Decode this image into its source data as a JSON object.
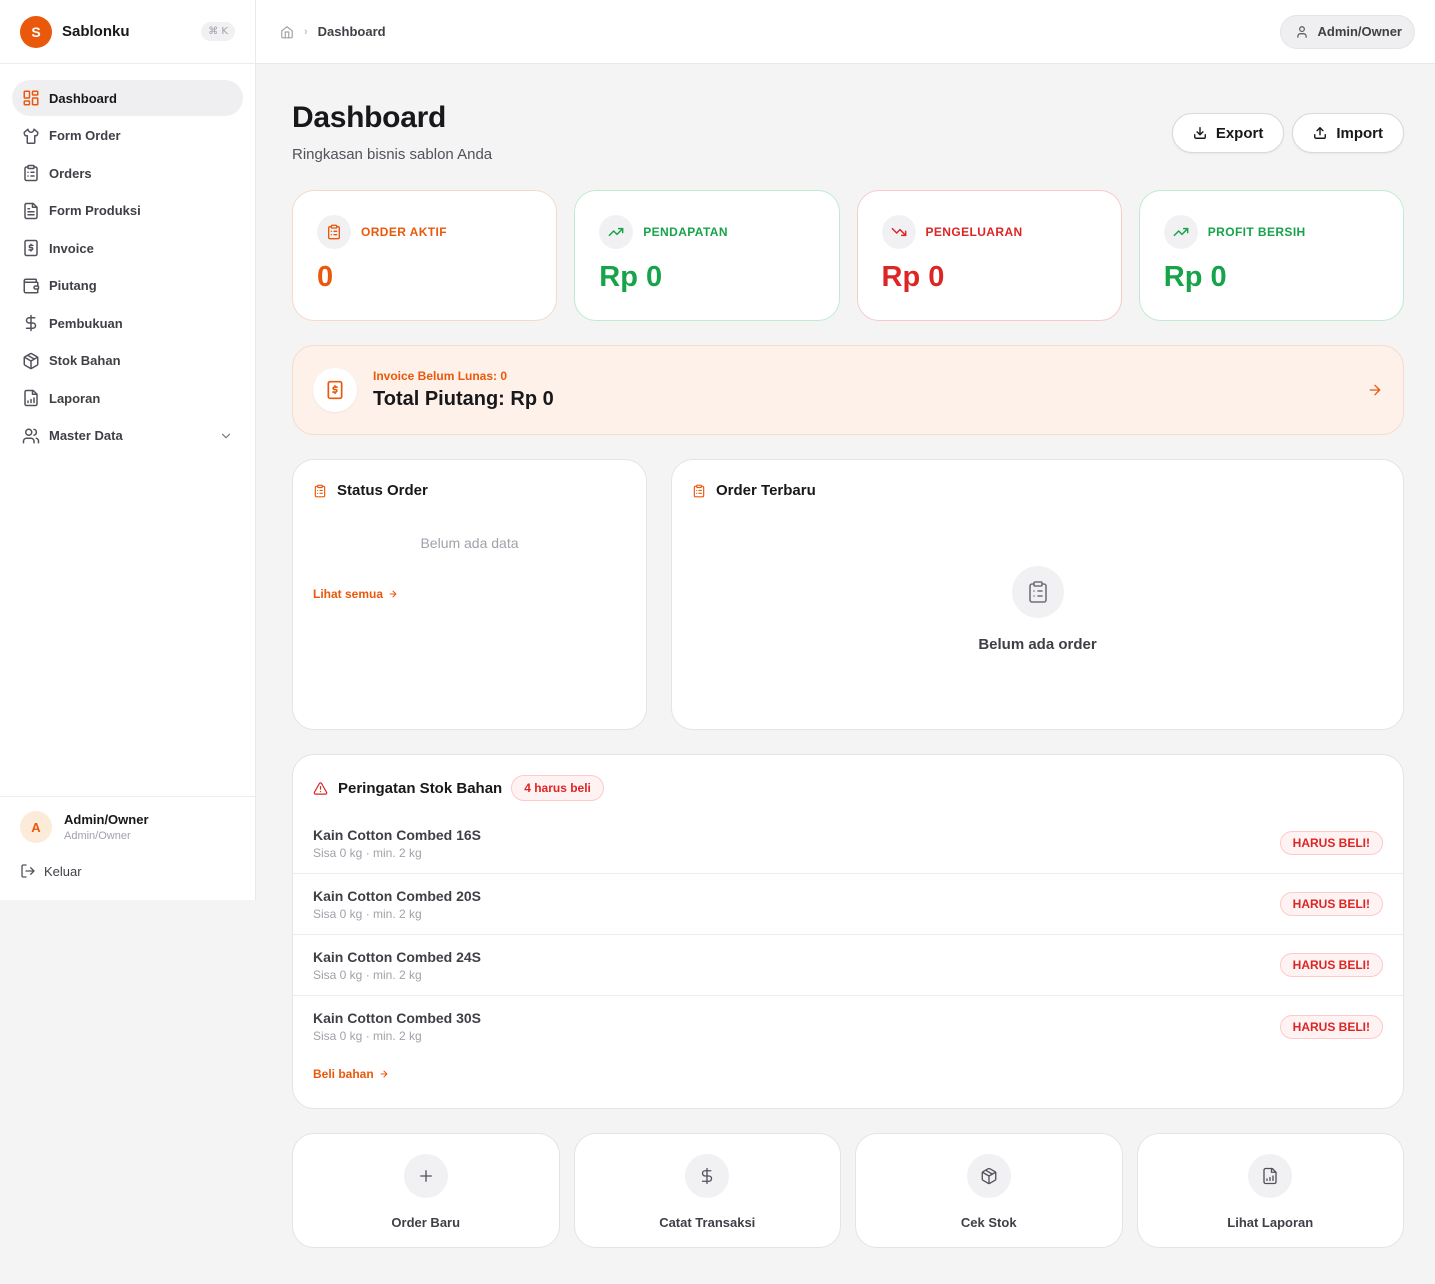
{
  "brand": {
    "logo_letter": "S",
    "name": "Sablonku",
    "shortcut": "⌘ K"
  },
  "nav": [
    {
      "label": "Dashboard",
      "icon": "layout-dashboard-icon",
      "active": true
    },
    {
      "label": "Form Order",
      "icon": "shirt-icon"
    },
    {
      "label": "Orders",
      "icon": "clipboard-list-icon"
    },
    {
      "label": "Form Produksi",
      "icon": "file-text-icon"
    },
    {
      "label": "Invoice",
      "icon": "receipt-icon"
    },
    {
      "label": "Piutang",
      "icon": "wallet-icon"
    },
    {
      "label": "Pembukuan",
      "icon": "dollar-sign-icon"
    },
    {
      "label": "Stok Bahan",
      "icon": "package-icon"
    },
    {
      "label": "Laporan",
      "icon": "file-chart-icon"
    },
    {
      "label": "Master Data",
      "icon": "users-icon",
      "has_submenu": true
    }
  ],
  "sidebar_user": {
    "avatar_letter": "A",
    "name": "Admin/Owner",
    "role": "Admin/Owner",
    "logout_label": "Keluar"
  },
  "topbar": {
    "breadcrumb_current": "Dashboard",
    "account_label": "Admin/Owner"
  },
  "header": {
    "title": "Dashboard",
    "subtitle": "Ringkasan bisnis sablon Anda",
    "export_label": "Export",
    "import_label": "Import"
  },
  "stats": [
    {
      "label": "ORDER AKTIF",
      "value": "0",
      "icon": "clipboard-list-icon",
      "color": "#ea580c",
      "border": "#f8d9c6"
    },
    {
      "label": "PENDAPATAN",
      "value": "Rp 0",
      "icon": "trending-up-icon",
      "color": "#16a34a",
      "border": "#bfeccf"
    },
    {
      "label": "PENGELUARAN",
      "value": "Rp 0",
      "icon": "trending-down-icon",
      "color": "#dc2626",
      "border": "#f8c9cb"
    },
    {
      "label": "PROFIT BERSIH",
      "value": "Rp 0",
      "icon": "trending-up-icon",
      "color": "#16a34a",
      "border": "#bfeccf"
    }
  ],
  "piutang": {
    "sub": "Invoice Belum Lunas: 0",
    "main": "Total Piutang: Rp 0"
  },
  "status_order": {
    "title": "Status Order",
    "empty": "Belum ada data",
    "link": "Lihat semua"
  },
  "order_terbaru": {
    "title": "Order Terbaru",
    "empty": "Belum ada order"
  },
  "stock_warning": {
    "title": "Peringatan Stok Bahan",
    "count_badge": "4 harus beli",
    "items": [
      {
        "name": "Kain Cotton Combed 16S",
        "meta": "Sisa 0 kg · min. 2 kg",
        "badge": "HARUS BELI!"
      },
      {
        "name": "Kain Cotton Combed 20S",
        "meta": "Sisa 0 kg · min. 2 kg",
        "badge": "HARUS BELI!"
      },
      {
        "name": "Kain Cotton Combed 24S",
        "meta": "Sisa 0 kg · min. 2 kg",
        "badge": "HARUS BELI!"
      },
      {
        "name": "Kain Cotton Combed 30S",
        "meta": "Sisa 0 kg · min. 2 kg",
        "badge": "HARUS BELI!"
      }
    ],
    "link": "Beli bahan"
  },
  "quick_actions": [
    {
      "label": "Order Baru",
      "icon": "plus-icon"
    },
    {
      "label": "Catat Transaksi",
      "icon": "dollar-sign-icon"
    },
    {
      "label": "Cek Stok",
      "icon": "package-icon"
    },
    {
      "label": "Lihat Laporan",
      "icon": "file-chart-icon"
    }
  ],
  "colors": {
    "accent": "#ea580c",
    "success": "#16a34a",
    "danger": "#dc2626"
  }
}
